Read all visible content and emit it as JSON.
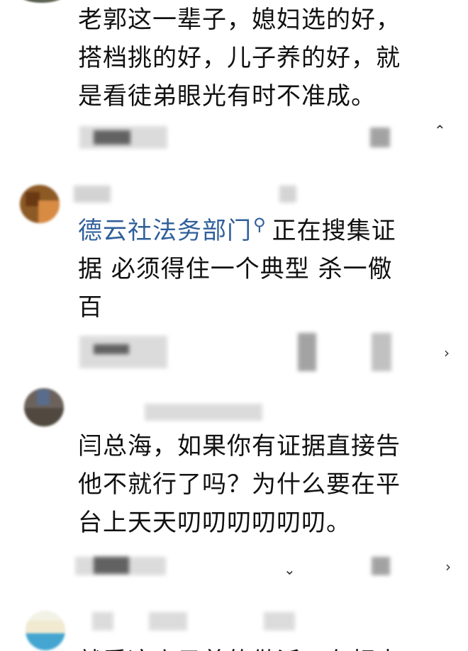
{
  "comments": [
    {
      "lines": [
        "老郭这一辈子，媳妇选的好，",
        "搭档挑的好，儿子养的好，就",
        "是看徒弟眼光有时不准成。"
      ]
    },
    {
      "mention": "德云社法务部门",
      "lines": [
        "正在搜集证",
        "据 必须得住一个典型 杀一儆",
        "百"
      ]
    },
    {
      "lines": [
        "闫总海，如果你有证据直接告",
        "他不就行了吗？为什么要在平",
        "台上天天叨叨叨叨叨叨。"
      ]
    },
    {
      "lines": [
        "就看这小子着的做派，在相声"
      ]
    }
  ],
  "icons": {
    "search": "search-icon",
    "chevron": "chevron-right-icon",
    "reply": "reply-icon"
  },
  "colors": {
    "link": "#2f5f9a",
    "text": "#111111",
    "background": "#ffffff"
  }
}
